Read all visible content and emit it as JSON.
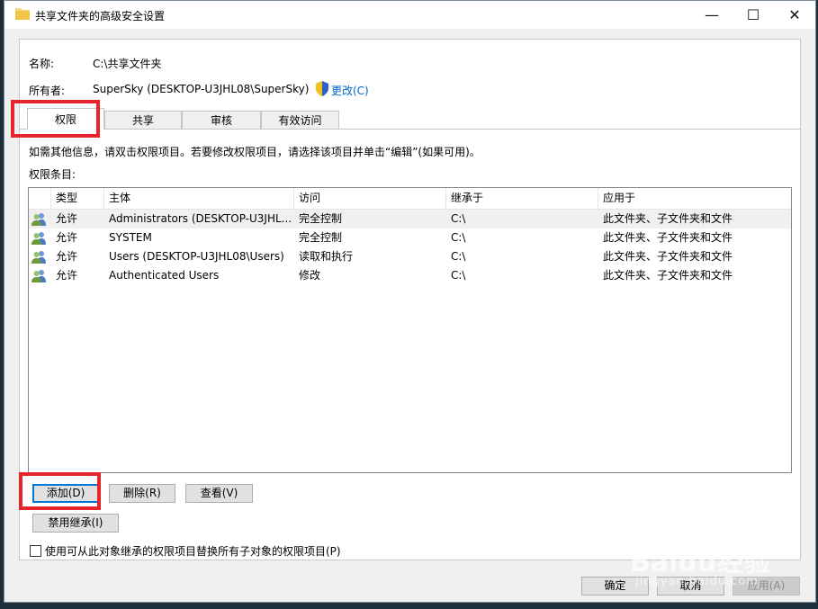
{
  "window": {
    "title": "共享文件夹的高级安全设置",
    "controls": {
      "minimize": "—",
      "maximize": "☐",
      "close": "✕"
    }
  },
  "info": {
    "name_label": "名称:",
    "name_value": "C:\\共享文件夹",
    "owner_label": "所有者:",
    "owner_value": "SuperSky (DESKTOP-U3JHL08\\SuperSky)",
    "change_link": "更改(C)"
  },
  "tabs": [
    {
      "label": "权限",
      "active": true
    },
    {
      "label": "共享"
    },
    {
      "label": "审核"
    },
    {
      "label": "有效访问"
    }
  ],
  "hint": "如需其他信息，请双击权限项目。若要修改权限项目，请选择该项目并单击“编辑”(如果可用)。",
  "entries_label": "权限条目:",
  "list": {
    "columns": [
      "类型",
      "主体",
      "访问",
      "继承于",
      "应用于"
    ],
    "rows": [
      [
        "允许",
        "Administrators (DESKTOP-U3JHL...",
        "完全控制",
        "C:\\",
        "此文件夹、子文件夹和文件"
      ],
      [
        "允许",
        "SYSTEM",
        "完全控制",
        "C:\\",
        "此文件夹、子文件夹和文件"
      ],
      [
        "允许",
        "Users (DESKTOP-U3JHL08\\Users)",
        "读取和执行",
        "C:\\",
        "此文件夹、子文件夹和文件"
      ],
      [
        "允许",
        "Authenticated Users",
        "修改",
        "C:\\",
        "此文件夹、子文件夹和文件"
      ]
    ]
  },
  "buttons": {
    "add": "添加(D)",
    "remove": "删除(R)",
    "view": "查看(V)",
    "disable_inheritance": "禁用继承(I)",
    "ok": "确定",
    "cancel": "取消",
    "apply": "应用(A)"
  },
  "replace_checkbox": {
    "label": "使用可从此对象继承的权限项目替换所有子对象的权限项目(P)",
    "checked": false
  },
  "watermark": {
    "logo": "Baidu经验",
    "url": "jingyan.baidu.com"
  },
  "colors": {
    "highlight": "#e5242b",
    "link": "#0066cc",
    "accent": "#0078d7"
  }
}
